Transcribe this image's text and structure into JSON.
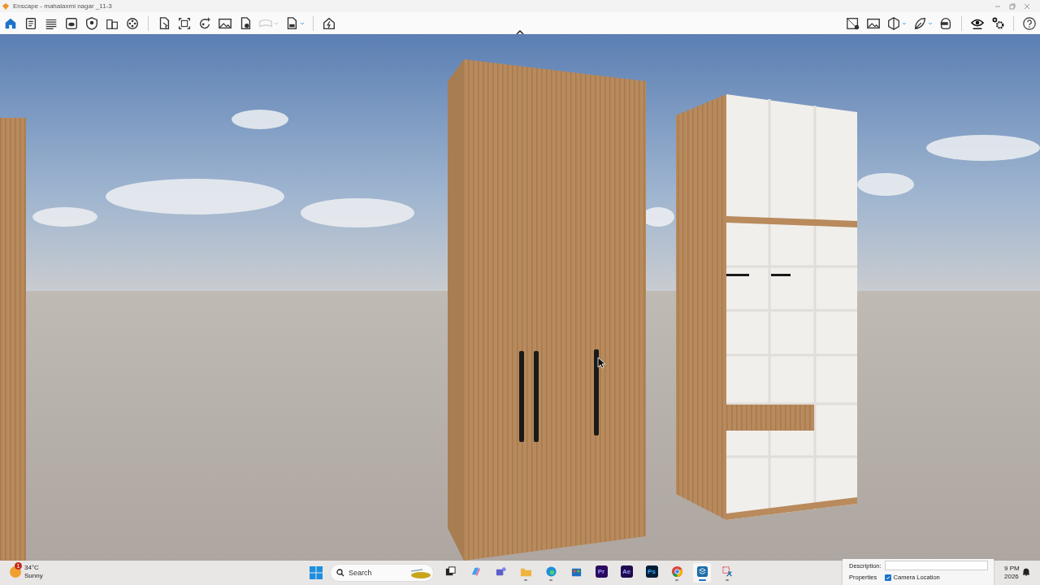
{
  "window": {
    "title": "Enscape - mahalaxmi nagar _11-3"
  },
  "toolbar_left": [
    {
      "selected": true,
      "disabled": false,
      "dropdown": false
    },
    {
      "selected": false,
      "disabled": false,
      "dropdown": false
    },
    {
      "selected": false,
      "disabled": false,
      "dropdown": false
    },
    {
      "selected": false,
      "disabled": false,
      "dropdown": false
    },
    {
      "selected": false,
      "disabled": false,
      "dropdown": false
    },
    {
      "selected": false,
      "disabled": false,
      "dropdown": false
    },
    {
      "selected": false,
      "disabled": false,
      "dropdown": false
    },
    {
      "selected": false,
      "disabled": false,
      "dropdown": false
    },
    {
      "selected": false,
      "disabled": false,
      "dropdown": false
    },
    {
      "selected": false,
      "disabled": false,
      "dropdown": false
    },
    {
      "selected": false,
      "disabled": false,
      "dropdown": false
    },
    {
      "selected": false,
      "disabled": false,
      "dropdown": false
    },
    {
      "selected": false,
      "disabled": true,
      "dropdown": true
    },
    {
      "selected": false,
      "disabled": false,
      "dropdown": true
    },
    {
      "selected": false,
      "disabled": false,
      "dropdown": false
    }
  ],
  "toolbar_right": [
    {
      "dropdown": false
    },
    {
      "dropdown": false
    },
    {
      "dropdown": true
    },
    {
      "dropdown": true
    },
    {
      "dropdown": false
    },
    {
      "dropdown": false
    },
    {
      "dropdown": false
    },
    {
      "dropdown": false
    }
  ],
  "taskbar": {
    "weather": {
      "temperature": "34°C",
      "condition": "Sunny",
      "badge": "1"
    },
    "search": {
      "placeholder": "Search"
    },
    "apps": [
      {
        "selected": false,
        "running": false
      },
      {
        "selected": false,
        "running": false
      },
      {
        "selected": false,
        "running": false
      },
      {
        "selected": false,
        "running": true
      },
      {
        "selected": false,
        "running": true
      },
      {
        "selected": false,
        "running": false
      },
      {
        "label": "Pr",
        "selected": false,
        "running": false
      },
      {
        "label": "Ae",
        "selected": false,
        "running": false
      },
      {
        "label": "Ps",
        "selected": false,
        "running": false
      },
      {
        "selected": false,
        "running": true
      },
      {
        "selected": true,
        "running": true
      },
      {
        "selected": false,
        "running": true
      }
    ],
    "clock": {
      "time": "9 PM",
      "date": "2026"
    }
  },
  "properties_panel": {
    "description_label": "Description:",
    "properties_label": "Properties",
    "camera_location": {
      "label": "Camera Location",
      "checked": true
    }
  }
}
